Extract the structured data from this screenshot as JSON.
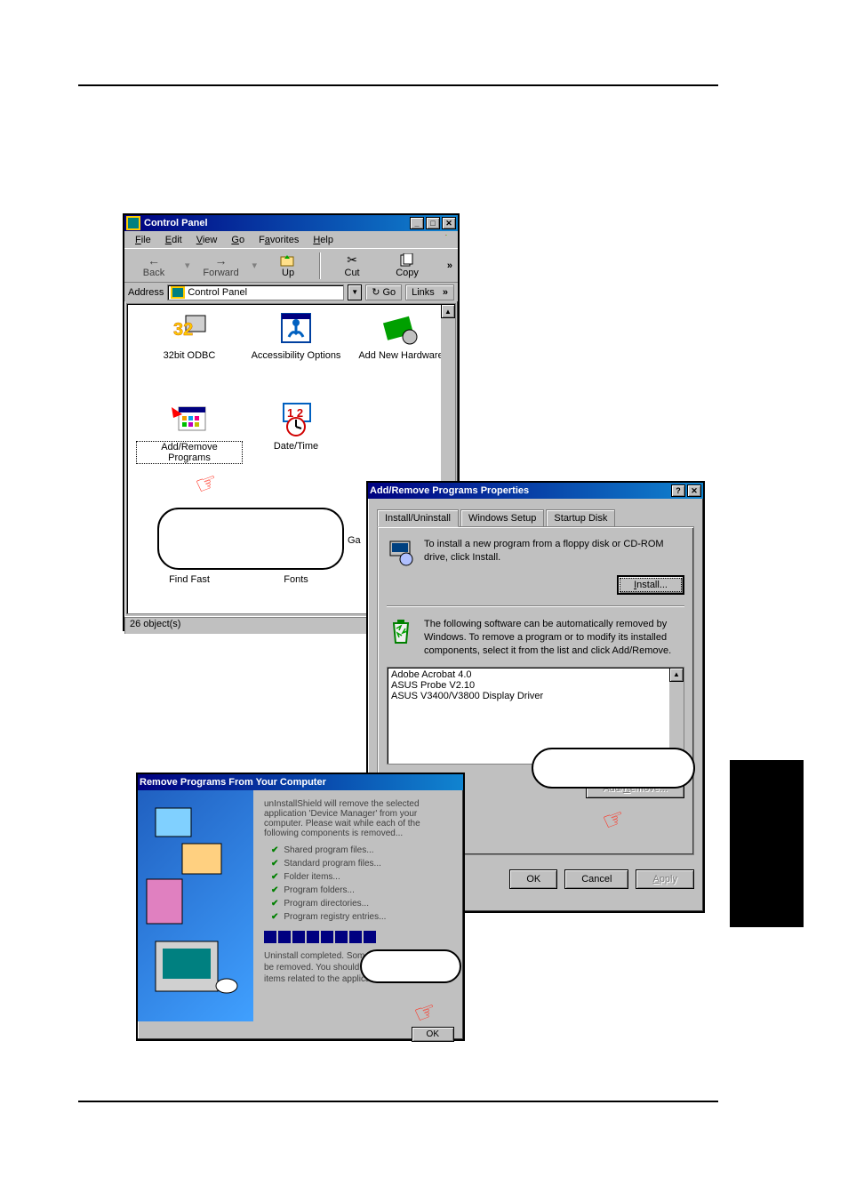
{
  "control_panel": {
    "title": "Control Panel",
    "menus": {
      "file": "File",
      "edit": "Edit",
      "view": "View",
      "go": "Go",
      "favorites": "Favorites",
      "help": "Help"
    },
    "toolbar": {
      "back": "Back",
      "forward": "Forward",
      "up": "Up",
      "cut": "Cut",
      "copy": "Copy"
    },
    "address_label": "Address",
    "address_value": "Control Panel",
    "go": "Go",
    "links": "Links",
    "items": {
      "odbc": "32bit ODBC",
      "accessibility": "Accessibility Options",
      "add_hw": "Add New Hardware",
      "add_remove_1": "Add/Remove",
      "add_remove_2": "Programs",
      "datetime": "Date/Time",
      "findfast": "Find Fast",
      "fonts": "Fonts",
      "ga": "Ga"
    },
    "status": "26 object(s)"
  },
  "arp": {
    "title": "Add/Remove Programs Properties",
    "tabs": {
      "install": "Install/Uninstall",
      "winsetup": "Windows Setup",
      "startup": "Startup Disk"
    },
    "install_text": "To install a new program from a floppy disk or CD-ROM drive, click Install.",
    "install_btn": "Install...",
    "remove_text": "The following software can be automatically removed by Windows. To remove a program or to modify its installed components, select it from the list and click Add/Remove.",
    "list": [
      "Adobe Acrobat 4.0",
      "ASUS Probe V2.10",
      "ASUS V3400/V3800 Display Driver"
    ],
    "add_remove_btn": "Add/Remove...",
    "ok": "OK",
    "cancel": "Cancel",
    "apply": "Apply"
  },
  "uninstall": {
    "title": "Remove Programs From Your Computer",
    "intro": "unInstallShield will remove the selected application 'Device Manager' from your computer. Please wait while each of the following components is removed...",
    "items": [
      "Shared program files...",
      "Standard program files...",
      "Folder items...",
      "Program folders...",
      "Program directories...",
      "Program registry entries..."
    ],
    "done": "Uninstall completed. Some elements could not be removed. You should manually remove items related to the application.",
    "ok": "OK"
  }
}
